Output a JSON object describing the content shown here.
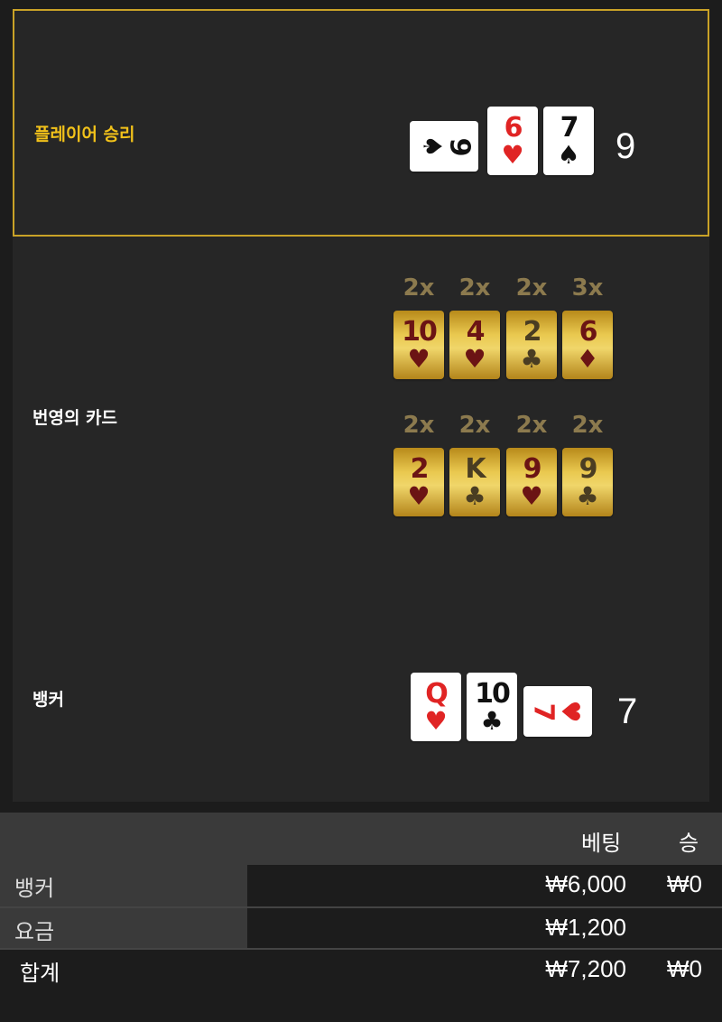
{
  "player": {
    "label": "플레이어 승리",
    "score": "9",
    "cards": [
      {
        "rank": "9",
        "suit": "♠",
        "color": "black",
        "sideways": true
      },
      {
        "rank": "6",
        "suit": "♥",
        "color": "red",
        "sideways": false
      },
      {
        "rank": "7",
        "suit": "♠",
        "color": "black",
        "sideways": false
      }
    ]
  },
  "lightning": {
    "label": "번영의 카드",
    "rows": [
      [
        {
          "mult": "2x",
          "rank": "10",
          "suit": "♥"
        },
        {
          "mult": "2x",
          "rank": "4",
          "suit": "♥"
        },
        {
          "mult": "2x",
          "rank": "2",
          "suit": "♣"
        },
        {
          "mult": "3x",
          "rank": "6",
          "suit": "♦"
        }
      ],
      [
        {
          "mult": "2x",
          "rank": "2",
          "suit": "♥"
        },
        {
          "mult": "2x",
          "rank": "K",
          "suit": "♣"
        },
        {
          "mult": "2x",
          "rank": "9",
          "suit": "♥"
        },
        {
          "mult": "2x",
          "rank": "9",
          "suit": "♣"
        }
      ]
    ]
  },
  "banker": {
    "label": "뱅커",
    "score": "7",
    "cards": [
      {
        "rank": "Q",
        "suit": "♥",
        "color": "red",
        "sideways": false
      },
      {
        "rank": "10",
        "suit": "♣",
        "color": "black",
        "sideways": false
      },
      {
        "rank": "7",
        "suit": "♥",
        "color": "red",
        "sideways": true
      }
    ]
  },
  "table": {
    "headers": {
      "bet": "베팅",
      "win": "승"
    },
    "rows": [
      {
        "name": "뱅커",
        "bet": "₩6,000",
        "win": "₩0"
      },
      {
        "name": "요금",
        "bet": "₩1,200",
        "win": ""
      },
      {
        "name": "합계",
        "bet": "₩7,200",
        "win": "₩0"
      }
    ]
  },
  "colors": {
    "accent": "#f2c21a",
    "background": "#262626",
    "red": "#e02424"
  }
}
